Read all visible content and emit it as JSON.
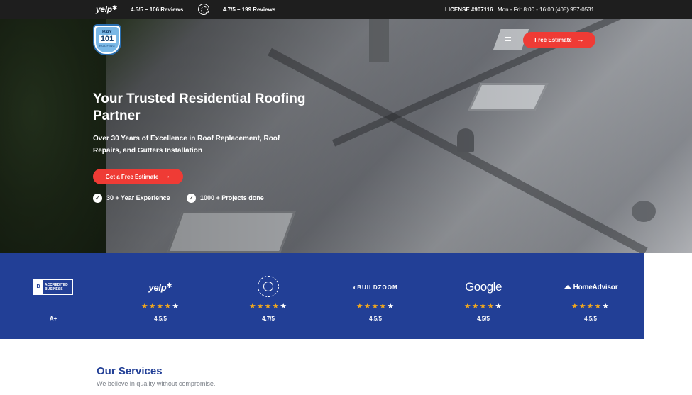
{
  "topbar": {
    "yelp_brand": "yelp",
    "yelp_reviews": "4.5/5 – 106 Reviews",
    "diamond_reviews": "4.7/5 – 199 Reviews",
    "license": "LICENSE #907116",
    "hours_phone": "Mon - Fri: 8:00 - 16:00 (408) 957-0531"
  },
  "logo": {
    "line1": "BAY",
    "line2": "101",
    "line3": "ROOFING"
  },
  "header": {
    "cta_label": "Free Estimate"
  },
  "hero": {
    "title": "Your Trusted Residential Roofing Partner",
    "subtitle": "Over 30 Years of Excellence in Roof Replacement, Roof Repairs, and Gutters Installation",
    "cta_label": "Get a Free Estimate",
    "features": [
      "30 + Year Experience",
      "1000 + Projects done"
    ]
  },
  "ratings": [
    {
      "name": "BBB Accredited Business",
      "logo_line1": "ACCREDITED",
      "logo_line2": "BUSINESS",
      "value": "A+",
      "stars": 0
    },
    {
      "name": "Yelp",
      "logo_text": "yelp",
      "value": "4.5/5",
      "stars": 4
    },
    {
      "name": "Diamond Certified",
      "value": "4.7/5",
      "stars": 4
    },
    {
      "name": "BuildZoom",
      "logo_text": "BUILDZOOM",
      "value": "4.5/5",
      "stars": 4
    },
    {
      "name": "Google",
      "logo_text": "Google",
      "value": "4.5/5",
      "stars": 4
    },
    {
      "name": "HomeAdvisor",
      "logo_text": "HomeAdvisor",
      "value": "4.5/5",
      "stars": 4
    }
  ],
  "services": {
    "title": "Our Services",
    "subtitle": "We believe in quality without compromise."
  },
  "colors": {
    "accent": "#ef3b35",
    "brand_blue": "#223f96",
    "topbar": "#1e1e1e",
    "star": "#f2a81d"
  },
  "icons": [
    "yelp-burst-icon",
    "diamond-certified-icon",
    "menu-icon",
    "arrow-right-icon",
    "check-circle-icon",
    "star-icon"
  ]
}
